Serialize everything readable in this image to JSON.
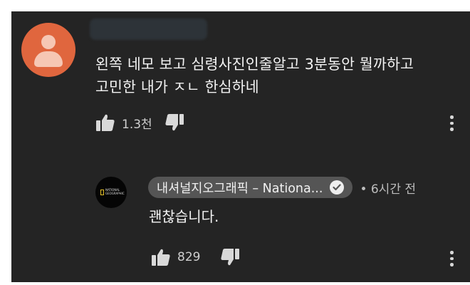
{
  "comment": {
    "text_line1": "왼쪽 네모 보고 심령사진인줄알고 3분동안 뭘까하고",
    "text_line2": "고민한 내가 ㅈㄴ 한심하네",
    "like_count": "1.3천"
  },
  "reply": {
    "channel_name": "내셔널지오그래픽 – Nationa...",
    "meta": "• 6시간 전",
    "text": "괜찮습니다.",
    "like_count": "829",
    "logo_text_line1": "NATIONAL",
    "logo_text_line2": "GEOGRAPHIC"
  },
  "icons": [
    "avatar-icon",
    "thumbs-up-icon",
    "thumbs-down-icon",
    "more-vert-icon",
    "verified-check-icon",
    "natgeo-logo"
  ],
  "colors": {
    "background": "#242424",
    "avatar_orange": "#e0663e",
    "natgeo_yellow": "#e6c22a",
    "chip_gray": "#555555"
  }
}
